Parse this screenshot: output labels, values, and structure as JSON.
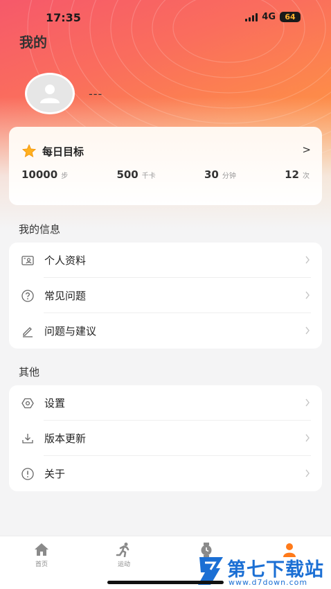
{
  "status": {
    "time": "17:35",
    "network": "4G",
    "battery": "64"
  },
  "header": {
    "title": "我的"
  },
  "profile": {
    "username": "---"
  },
  "goal": {
    "title": "每日目标",
    "arrow": ">",
    "stats": [
      {
        "value": "10000",
        "unit": "步"
      },
      {
        "value": "500",
        "unit": "千卡"
      },
      {
        "value": "30",
        "unit": "分钟"
      },
      {
        "value": "12",
        "unit": "次"
      }
    ]
  },
  "my_info": {
    "heading": "我的信息",
    "items": [
      {
        "label": "个人资料",
        "icon": "id-card-icon"
      },
      {
        "label": "常见问题",
        "icon": "question-circle-icon"
      },
      {
        "label": "问题与建议",
        "icon": "pencil-icon"
      }
    ]
  },
  "other": {
    "heading": "其他",
    "items": [
      {
        "label": "设置",
        "icon": "settings-icon"
      },
      {
        "label": "版本更新",
        "icon": "download-icon"
      },
      {
        "label": "关于",
        "icon": "info-circle-icon"
      }
    ]
  },
  "tabbar": {
    "tabs": [
      {
        "label": "首页",
        "icon": "home-icon"
      },
      {
        "label": "运动",
        "icon": "running-icon"
      },
      {
        "label": "",
        "icon": "watch-icon"
      },
      {
        "label": "",
        "icon": "user-icon"
      }
    ],
    "active_color": "#ff7a1a"
  },
  "watermark": {
    "title": "第七下载站",
    "url": "www.d7down.com"
  },
  "colors": {
    "accent": "#ff7a1a",
    "hero_start": "#f6596a",
    "hero_end": "#ffa53d"
  }
}
